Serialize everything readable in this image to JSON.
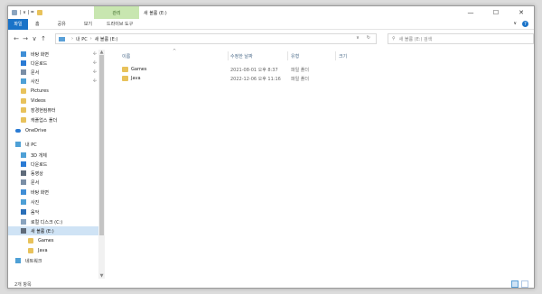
{
  "titlebar": {
    "quick_access_label": "| ∨ | =",
    "contextual_tab": "관리",
    "title": "새 볼륨 (E:)",
    "minimize": "—",
    "maximize": "☐",
    "close": "✕"
  },
  "ribbon": {
    "tabs": [
      "파일",
      "홈",
      "공유",
      "보기",
      "드라이브 도구"
    ],
    "collapse": "∨",
    "help": "?"
  },
  "address": {
    "back": "←",
    "forward": "→",
    "up_menu": "∨",
    "up": "↑",
    "crumbs": [
      "내 PC",
      "새 볼륨 (E:)"
    ],
    "dropdown": "∨",
    "refresh": "↻",
    "search_placeholder": "새 볼륨 (E:) 검색"
  },
  "nav": {
    "items": [
      {
        "label": "바탕 화면",
        "icon": "desktop-icon",
        "pinned": true,
        "color": "#3f8ed6"
      },
      {
        "label": "다운로드",
        "icon": "download-icon",
        "pinned": true,
        "color": "#2a7bd4"
      },
      {
        "label": "문서",
        "icon": "documents-icon",
        "pinned": true,
        "color": "#7a8ea6"
      },
      {
        "label": "사진",
        "icon": "pictures-icon",
        "pinned": true,
        "color": "#4ea0d6"
      },
      {
        "label": "Pictures",
        "icon": "folder-icon",
        "pinned": false,
        "color": "#e8c25b"
      },
      {
        "label": "Videos",
        "icon": "folder-icon",
        "pinned": false,
        "color": "#e8c25b"
      },
      {
        "label": "장경현컴퓨터",
        "icon": "folder-icon",
        "pinned": false,
        "color": "#e8c25b"
      },
      {
        "label": "캐플업스 폴더",
        "icon": "folder-icon",
        "pinned": false,
        "color": "#e8c25b"
      },
      {
        "label": "OneDrive",
        "icon": "onedrive-icon",
        "pinned": false,
        "color": "#2a7bd4"
      },
      {
        "label": "내 PC",
        "icon": "pc-icon",
        "pinned": false,
        "color": "#4ea0d6"
      },
      {
        "label": "3D 개체",
        "icon": "3d-objects-icon",
        "pinned": false,
        "color": "#4ea0d6"
      },
      {
        "label": "다운로드",
        "icon": "download-icon",
        "pinned": false,
        "color": "#2a7bd4"
      },
      {
        "label": "동영상",
        "icon": "videos-icon",
        "pinned": false,
        "color": "#5f6b7a"
      },
      {
        "label": "문서",
        "icon": "documents-icon",
        "pinned": false,
        "color": "#7a8ea6"
      },
      {
        "label": "바탕 화면",
        "icon": "desktop-icon",
        "pinned": false,
        "color": "#3f8ed6"
      },
      {
        "label": "사진",
        "icon": "pictures-icon",
        "pinned": false,
        "color": "#4ea0d6"
      },
      {
        "label": "음악",
        "icon": "music-icon",
        "pinned": false,
        "color": "#2a6fb8"
      },
      {
        "label": "로컬 디스크 (C:)",
        "icon": "drive-icon",
        "pinned": false,
        "color": "#8aa4bf"
      },
      {
        "label": "새 볼륨 (E:)",
        "icon": "drive-icon",
        "pinned": false,
        "color": "#5f6b7a",
        "selected": true
      },
      {
        "label": "Games",
        "icon": "folder-icon",
        "pinned": false,
        "color": "#e8c25b"
      },
      {
        "label": "Java",
        "icon": "folder-icon",
        "pinned": false,
        "color": "#e8c25b"
      },
      {
        "label": "네트워크",
        "icon": "network-icon",
        "pinned": false,
        "color": "#4ea0d6"
      }
    ]
  },
  "columns": [
    "이름",
    "수정한 날짜",
    "유형",
    "크기"
  ],
  "sort_indicator": "^",
  "rows": [
    {
      "name": "Games",
      "date": "2021-08-01 오후 8:37",
      "type": "파일 폴더",
      "size": ""
    },
    {
      "name": "Java",
      "date": "2022-12-06 오후 11:16",
      "type": "파일 폴더",
      "size": ""
    }
  ],
  "status": {
    "count": "2개 항목"
  },
  "colors": {
    "accent": "#1a73c8",
    "folder": "#e8c25b",
    "selection": "#cfe3f5",
    "contextual": "#c8e6b0"
  }
}
